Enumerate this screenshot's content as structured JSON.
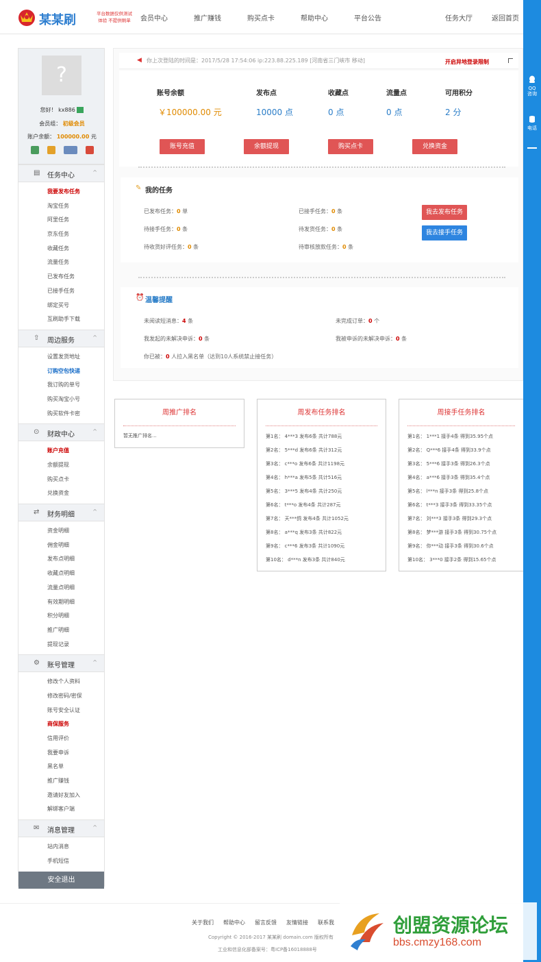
{
  "header": {
    "brand": "某某刷",
    "tagline1": "平台数据仅供测试",
    "tagline2": "体验 不提供刷单",
    "nav": [
      "会员中心",
      "推广赚钱",
      "购买点卡",
      "帮助中心",
      "平台公告"
    ],
    "nav_right": [
      "任务大厅",
      "返回首页"
    ]
  },
  "rightbar": {
    "qq": "QQ",
    "qq_sub": "咨询",
    "phone": "电话"
  },
  "profile": {
    "greet": "您好！",
    "user": "kx886",
    "level_label": "会员组：",
    "level": "初级会员",
    "balance_label": "账户余额：",
    "balance": "100000.00",
    "unit": "元"
  },
  "sidebar": {
    "task": {
      "title": "任务中心",
      "items": [
        "我要发布任务",
        "淘宝任务",
        "阿里任务",
        "京东任务",
        "收藏任务",
        "流量任务",
        "已发布任务",
        "已接手任务",
        "绑定买号",
        "互刷助手下载"
      ]
    },
    "service": {
      "title": "周边服务",
      "items": [
        "设置发货地址",
        "订购空包快递",
        "我订购的单号",
        "购买淘宝小号",
        "购买软件卡密"
      ]
    },
    "finance": {
      "title": "财政中心",
      "items": [
        "账户充值",
        "余额提现",
        "购买点卡",
        "兑换资金"
      ]
    },
    "detail": {
      "title": "财务明细",
      "items": [
        "资金明细",
        "佣金明细",
        "发布点明细",
        "收藏点明细",
        "流量点明细",
        "有效期明细",
        "积分明细",
        "推广明细",
        "提现记录"
      ]
    },
    "account": {
      "title": "账号管理",
      "items": [
        "修改个人资料",
        "修改密码/密保",
        "账号安全认证",
        "商保服务",
        "信用评价",
        "我要申诉",
        "黑名单",
        "推广赚钱",
        "邀请好友加入",
        "解绑客户端"
      ]
    },
    "message": {
      "title": "消息管理",
      "items": [
        "站内消息",
        "手机短信"
      ]
    },
    "logout": "安全退出"
  },
  "notice": {
    "text": "你上次登陆的时间是：2017/5/28 17:54:06   ip:223.88.225.189 [河南省三门峡市 移动]",
    "right": "开启异地登录限制"
  },
  "balance": {
    "labels": [
      "账号余额",
      "发布点",
      "收藏点",
      "流量点",
      "可用积分"
    ],
    "values": [
      "￥100000.00 元",
      "10000 点",
      "0 点",
      "0 点",
      "2 分"
    ],
    "buttons": [
      "账号充值",
      "余额提现",
      "购买点卡",
      "兑换资金"
    ]
  },
  "mytask": {
    "title": "我的任务",
    "l1": "已发布任务：",
    "v1": "0",
    "u1": "单",
    "l2": "已接手任务：",
    "v2": "0",
    "u2": "条",
    "l3": "待接手任务：",
    "v3": "0",
    "u3": "条",
    "l4": "待发货任务：",
    "v4": "0",
    "u4": "条",
    "l5": "待收货好评任务：",
    "v5": "0",
    "u5": "条",
    "l6": "待审核放款任务：",
    "v6": "0",
    "u6": "条",
    "btn1": "我去发布任务",
    "btn2": "我去接手任务"
  },
  "warm": {
    "title": "温馨提醒",
    "l1": "未阅读短消息：",
    "v1": "4",
    "u1": "条",
    "l2": "未完成订单：",
    "v2": "0",
    "u2": "个",
    "l3": "我发起的未解决申诉：",
    "v3": "0",
    "u3": "条",
    "l4": "我被申诉的未解决申诉：",
    "v4": "0",
    "u4": "条",
    "l5": "你已被：",
    "v5": "0",
    "u5": "人拉入黑名单（达到10人系统禁止接任务）"
  },
  "rank_promote": {
    "title": "周推广排名",
    "empty": "暂无推广排名..."
  },
  "rank_publish": {
    "title": "周发布任务排名",
    "rows": [
      "第1名：  4***3   发布6条    共计788元",
      "第2名：  5***d   发布6条    共计312元",
      "第3名：  c***o   发布6条    共计1198元",
      "第4名：  h***a   发布5条    共计516元",
      "第5名：  3***5   发布4条    共计250元",
      "第6名：  t***o   发布4条    共计287元",
      "第7名：  天***鸽   发布4条    共计1052元",
      "第8名：  a***q   发布3条    共计822元",
      "第9名：  c***6   发布3条    共计1090元",
      "第10名：  d***n   发布3条    共计840元"
    ]
  },
  "rank_accept": {
    "title": "周接手任务排名",
    "rows": [
      "第1名：  1***1   接手4条    得到35.95个点",
      "第2名：  Q***6   接手4条    得到33.9个点",
      "第3名：  5***6   接手3条    得到26.3个点",
      "第4名：  a***6   接手3条    得到35.4个点",
      "第5名：  l***n   接手3条    得到25.8个点",
      "第6名：  t***3   接手3条    得到33.35个点",
      "第7名：  刘***3   接手3条    得到29.3个点",
      "第8名：  梦***游   接手3条    得到30.75个点",
      "第9名：  你***动   接手3条    得到30.6个点",
      "第10名：  3***0   接手2条    得到15.65个点"
    ]
  },
  "footer": {
    "links": [
      "关于我们",
      "帮助中心",
      "留言反馈",
      "友情链接",
      "联系我"
    ],
    "copy": "Copyright © 2016-2017 某某刷  domain.com 版权所有",
    "icp": "工业和信息化部备案号：粤ICP备16018888号"
  },
  "watermark": {
    "title": "创盟资源论坛",
    "url": "bbs.cmzy168.com"
  },
  "colors": {
    "accent": "#1d8be0",
    "red": "#e05555",
    "orange": "#e08a00"
  }
}
